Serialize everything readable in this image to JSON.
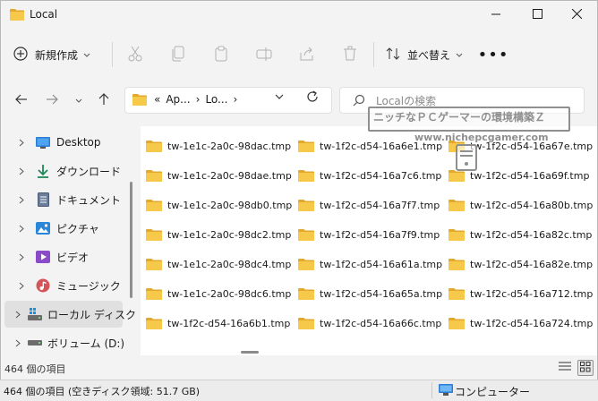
{
  "window": {
    "title": "Local",
    "controls": {
      "minimize": "minimize-icon",
      "maximize": "maximize-icon",
      "close": "close-icon"
    }
  },
  "toolbar": {
    "new_label": "新規作成",
    "sort_label": "並べ替え",
    "more_label": "•••",
    "icons": [
      "cut-icon",
      "copy-icon",
      "paste-icon",
      "rename-icon",
      "share-icon",
      "delete-icon"
    ]
  },
  "navigation": {
    "breadcrumb": [
      "«",
      "Ap...",
      "›",
      "Lo...",
      "›"
    ],
    "search_placeholder": "Localの検索"
  },
  "sidebar": {
    "items": [
      {
        "label": "Desktop",
        "icon": "desktop-icon",
        "selected": false
      },
      {
        "label": "ダウンロード",
        "icon": "download-icon",
        "selected": false
      },
      {
        "label": "ドキュメント",
        "icon": "document-icon",
        "selected": false
      },
      {
        "label": "ピクチャ",
        "icon": "pictures-icon",
        "selected": false
      },
      {
        "label": "ビデオ",
        "icon": "video-icon",
        "selected": false
      },
      {
        "label": "ミュージック",
        "icon": "music-icon",
        "selected": false
      },
      {
        "label": "ローカル ディスク",
        "icon": "local-disk-icon",
        "selected": true
      },
      {
        "label": "ボリューム (D:)",
        "icon": "drive-icon",
        "selected": false
      }
    ]
  },
  "files": {
    "columns": [
      [
        "tw-1e1c-2a0c-98dac.tmp",
        "tw-1e1c-2a0c-98dae.tmp",
        "tw-1e1c-2a0c-98db0.tmp",
        "tw-1e1c-2a0c-98dc2.tmp",
        "tw-1e1c-2a0c-98dc4.tmp",
        "tw-1e1c-2a0c-98dc6.tmp",
        "tw-1f2c-d54-16a6b1.tmp"
      ],
      [
        "tw-1f2c-d54-16a6e1.tmp",
        "tw-1f2c-d54-16a7c6.tmp",
        "tw-1f2c-d54-16a7f7.tmp",
        "tw-1f2c-d54-16a7f9.tmp",
        "tw-1f2c-d54-16a61a.tmp",
        "tw-1f2c-d54-16a65a.tmp",
        "tw-1f2c-d54-16a66c.tmp"
      ],
      [
        "tw-1f2c-d54-16a67e.tmp",
        "tw-1f2c-d54-16a69f.tmp",
        "tw-1f2c-d54-16a80b.tmp",
        "tw-1f2c-d54-16a82c.tmp",
        "tw-1f2c-d54-16a82e.tmp",
        "tw-1f2c-d54-16a712.tmp",
        "tw-1f2c-d54-16a724.tmp"
      ]
    ]
  },
  "status": {
    "item_count": "464 個の項目"
  },
  "bottom_bar": {
    "summary": "464 個の項目 (空きディスク領域: 51.7 GB)",
    "location": "コンピューター"
  },
  "watermark": {
    "line1": "ニッチなＰＣゲーマーの環境構築Ｚ",
    "line2": "www.nichepcgamer.com"
  },
  "colors": {
    "folder": "#f6c94a",
    "folder_dark": "#e2a92c",
    "accent": "#0067c0",
    "selected_bg": "#e0e0e0"
  }
}
